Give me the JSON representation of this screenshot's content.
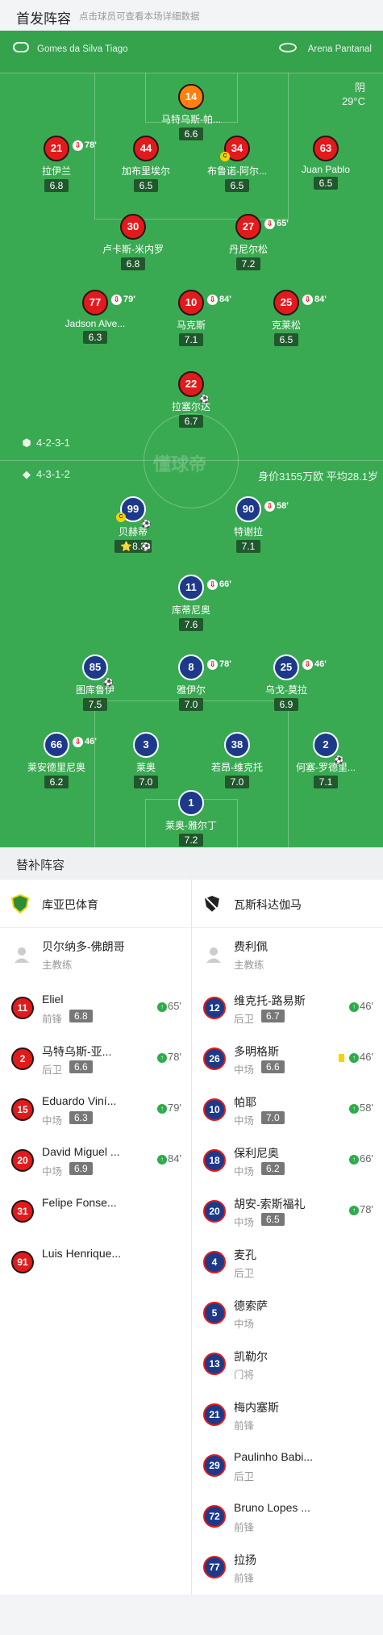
{
  "header": {
    "title": "首发阵容",
    "hint": "点击球员可查看本场详细数据"
  },
  "venue": {
    "referee": "Gomes da Silva Tiago",
    "stadium": "Arena Pantanal",
    "weather": "阴",
    "temperature": "29°C"
  },
  "home_lineup": [
    {
      "num": "14",
      "name": "马特乌斯-帕...",
      "rating": "6.6"
    },
    {
      "num": "21",
      "name": "拉伊兰",
      "rating": "6.8",
      "sub": "78'"
    },
    {
      "num": "44",
      "name": "加布里埃尔",
      "rating": "6.5"
    },
    {
      "num": "34",
      "name": "布鲁诺-阿尔...",
      "rating": "6.5",
      "card": "C"
    },
    {
      "num": "63",
      "name": "Juan Pablo",
      "rating": "6.5"
    },
    {
      "num": "30",
      "name": "卢卡斯-米内罗",
      "rating": "6.8"
    },
    {
      "num": "27",
      "name": "丹尼尔松",
      "rating": "7.2",
      "sub": "65'"
    },
    {
      "num": "77",
      "name": "Jadson Alve...",
      "rating": "6.3",
      "sub": "79'"
    },
    {
      "num": "10",
      "name": "马克斯",
      "rating": "7.1",
      "sub": "84'"
    },
    {
      "num": "25",
      "name": "克莱松",
      "rating": "6.5",
      "sub": "84'"
    },
    {
      "num": "22",
      "name": "拉塞尔达",
      "rating": "6.7",
      "ball": "⚽"
    }
  ],
  "formations": {
    "home": "4-2-3-1",
    "away": "4-3-1-2",
    "away_value": "身价3155万欧 平均28.1岁"
  },
  "watermark": "懂球帝",
  "away_lineup": [
    {
      "num": "99",
      "name": "贝赫蒂",
      "rating": "8.3",
      "star": "⭐",
      "card": "C",
      "ball": "⚽⚽"
    },
    {
      "num": "90",
      "name": "特谢拉",
      "rating": "7.1",
      "sub": "58'"
    },
    {
      "num": "11",
      "name": "库蒂尼奥",
      "rating": "7.6",
      "sub": "66'"
    },
    {
      "num": "85",
      "name": "图库鲁伊",
      "rating": "7.5",
      "ball": "⚽"
    },
    {
      "num": "8",
      "name": "雅伊尔",
      "rating": "7.0",
      "sub": "78'"
    },
    {
      "num": "25",
      "name": "乌戈-莫拉",
      "rating": "6.9",
      "sub": "46'"
    },
    {
      "num": "66",
      "name": "莱安德里尼奥",
      "rating": "6.2",
      "sub": "46'"
    },
    {
      "num": "3",
      "name": "莱奥",
      "rating": "7.0"
    },
    {
      "num": "38",
      "name": "若昂-维克托",
      "rating": "7.0"
    },
    {
      "num": "2",
      "name": "何塞-罗德里...",
      "rating": "7.1",
      "ball": "⚽"
    },
    {
      "num": "1",
      "name": "莱奥-雅尔丁",
      "rating": "7.2"
    }
  ],
  "subs": {
    "title": "替补阵容",
    "coach_role": "主教练",
    "home": {
      "team": "库亚巴体育",
      "coach": "贝尔纳多-佛朗哥",
      "players": [
        {
          "num": "11",
          "name": "Eliel",
          "pos": "前锋",
          "rating": "6.8",
          "min": "65'"
        },
        {
          "num": "2",
          "name": "马特乌斯-亚...",
          "pos": "后卫",
          "rating": "6.6",
          "min": "78'"
        },
        {
          "num": "15",
          "name": "Eduardo Viní...",
          "pos": "中场",
          "rating": "6.3",
          "min": "79'"
        },
        {
          "num": "20",
          "name": "David Miguel ...",
          "pos": "中场",
          "rating": "6.9",
          "min": "84'"
        },
        {
          "num": "31",
          "name": "Felipe Fonse...",
          "pos": ""
        },
        {
          "num": "91",
          "name": "Luis Henrique...",
          "pos": ""
        }
      ]
    },
    "away": {
      "team": "瓦斯科达伽马",
      "coach": "费利佩",
      "players": [
        {
          "num": "12",
          "name": "维克托-路易斯",
          "pos": "后卫",
          "rating": "6.7",
          "min": "46'"
        },
        {
          "num": "26",
          "name": "多明格斯",
          "pos": "中场",
          "rating": "6.6",
          "min": "46'",
          "yellow": true
        },
        {
          "num": "10",
          "name": "帕耶",
          "pos": "中场",
          "rating": "7.0",
          "min": "58'"
        },
        {
          "num": "18",
          "name": "保利尼奥",
          "pos": "中场",
          "rating": "6.2",
          "min": "66'"
        },
        {
          "num": "20",
          "name": "胡安-索斯福礼",
          "pos": "中场",
          "rating": "6.5",
          "min": "78'"
        },
        {
          "num": "4",
          "name": "麦孔",
          "pos": "后卫"
        },
        {
          "num": "5",
          "name": "德索萨",
          "pos": "中场"
        },
        {
          "num": "13",
          "name": "凯勒尔",
          "pos": "门将"
        },
        {
          "num": "21",
          "name": "梅内塞斯",
          "pos": "前锋"
        },
        {
          "num": "29",
          "name": "Paulinho Babi...",
          "pos": "后卫"
        },
        {
          "num": "72",
          "name": "Bruno Lopes ...",
          "pos": "前锋"
        },
        {
          "num": "77",
          "name": "拉扬",
          "pos": "前锋"
        }
      ]
    }
  }
}
